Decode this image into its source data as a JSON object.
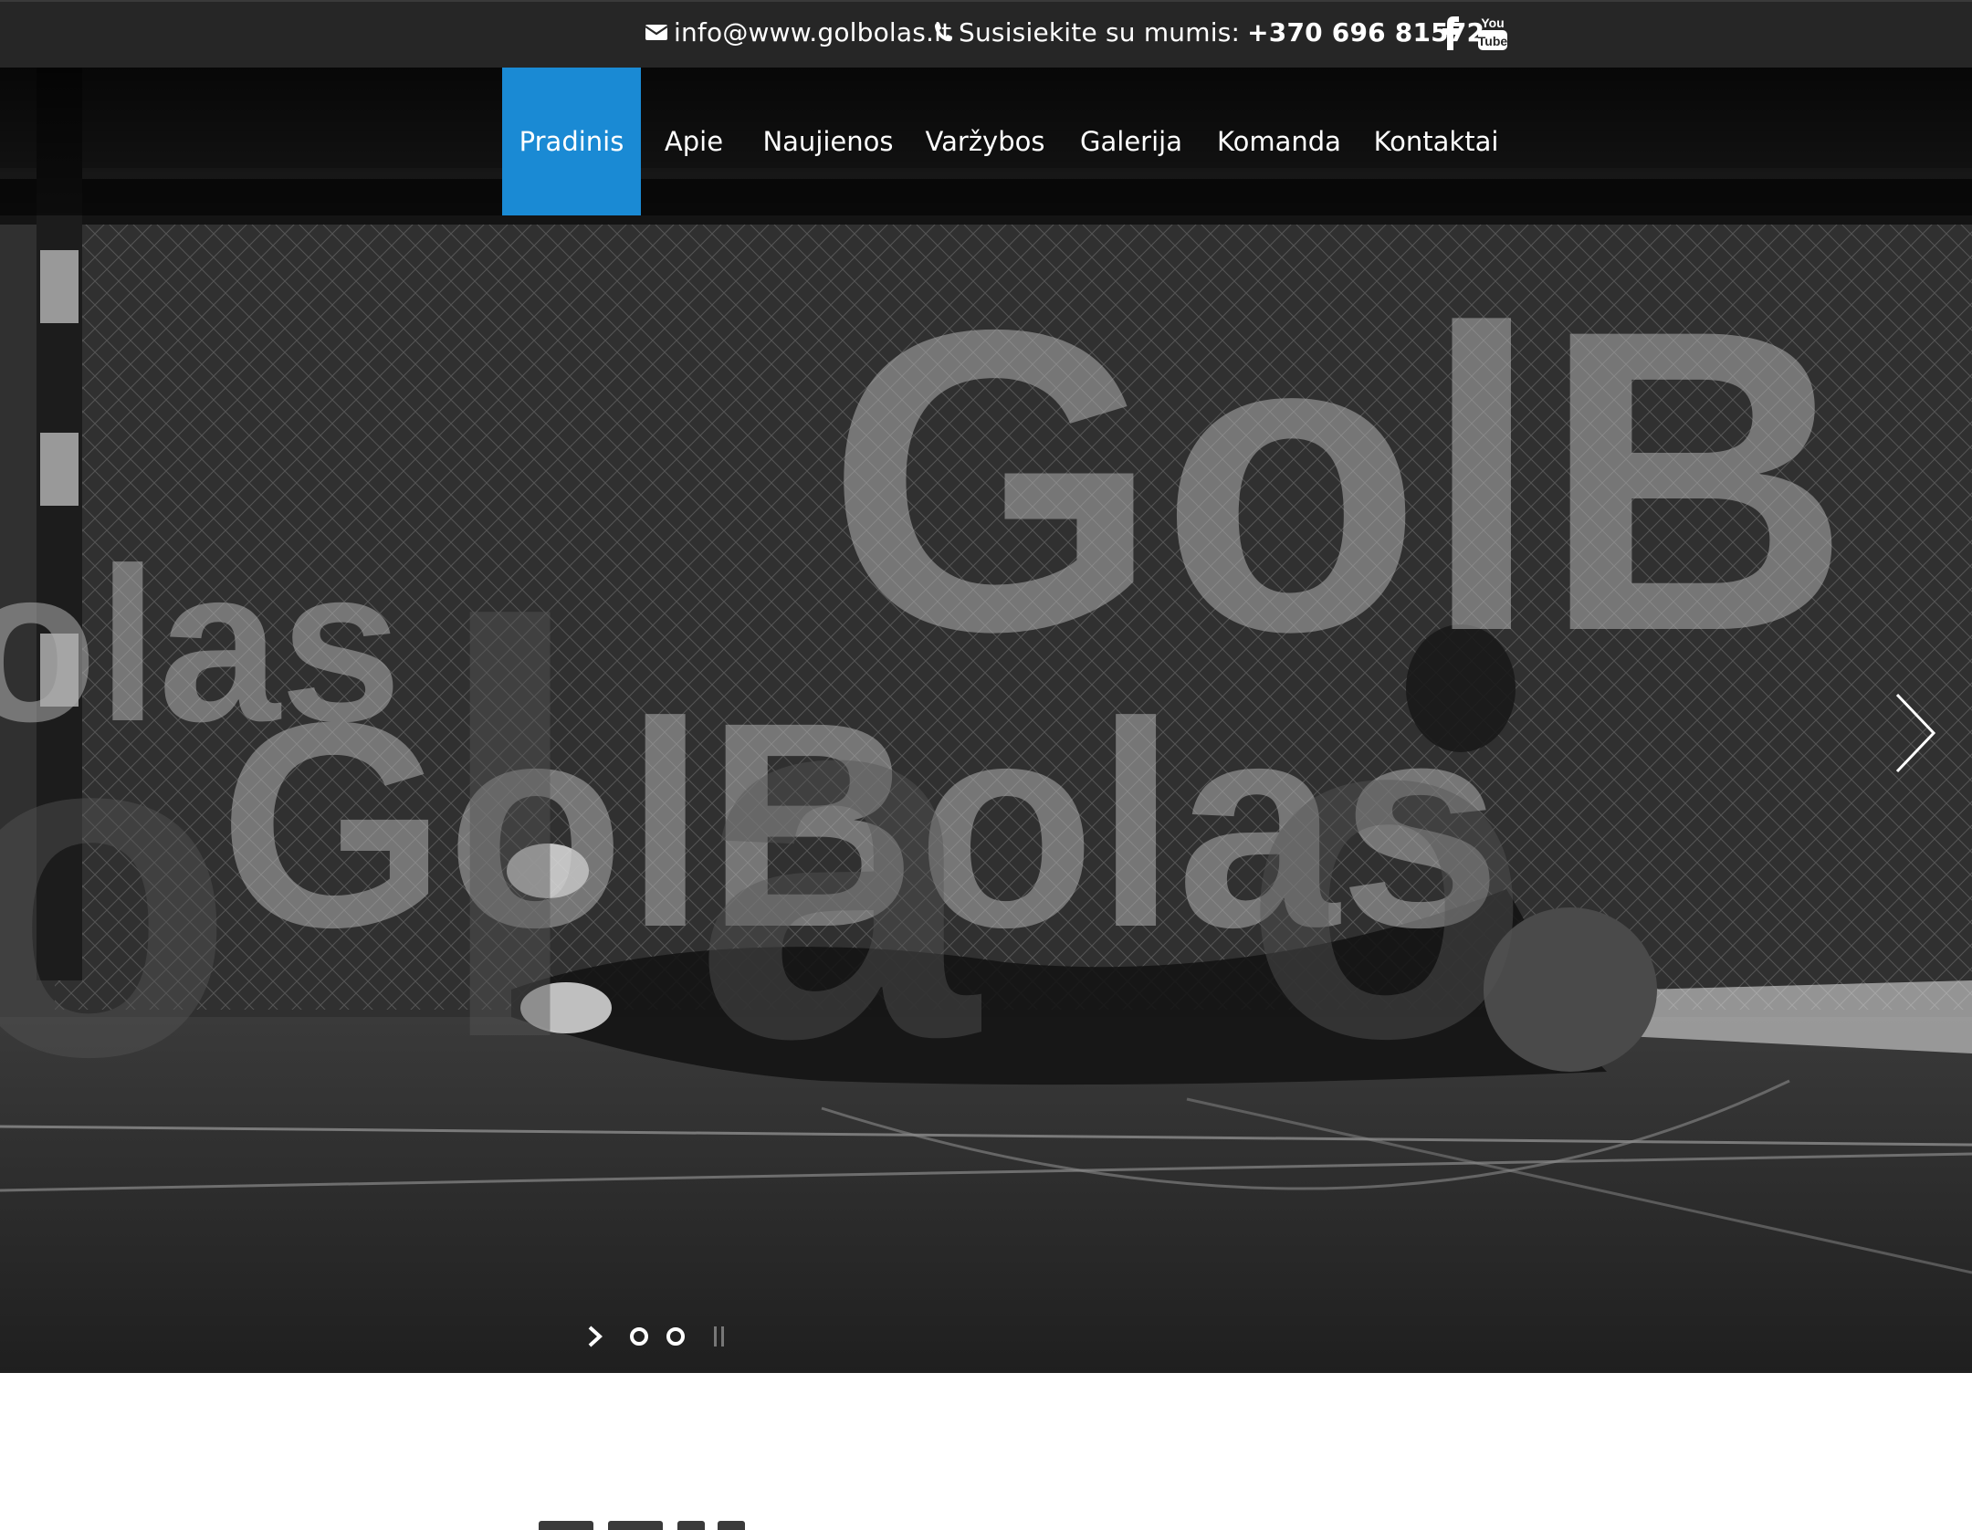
{
  "topbar": {
    "email": "info@www.golbolas.lt",
    "phone_label": "Susisiekite su mumis:",
    "phone_number": "+370 696 81572",
    "icons": {
      "email": "envelope-icon",
      "phone": "phone-icon",
      "facebook": "facebook-icon",
      "youtube": "youtube-icon"
    },
    "youtube_logo_text_top": "You",
    "youtube_logo_text_bottom": "Tube"
  },
  "nav": {
    "items": [
      {
        "label": "Pradinis",
        "active": true
      },
      {
        "label": "Apie",
        "active": false
      },
      {
        "label": "Naujienos",
        "active": false
      },
      {
        "label": "Varžybos",
        "active": false
      },
      {
        "label": "Galerija",
        "active": false
      },
      {
        "label": "Komanda",
        "active": false
      },
      {
        "label": "Kontaktai",
        "active": false
      }
    ],
    "active_color": "#1a8ad4"
  },
  "hero": {
    "overlay_words": [
      "olas",
      "GolB",
      "GolBolas",
      "o",
      "l",
      "a",
      "o"
    ],
    "slider": {
      "total_slides": 2,
      "icons": [
        "play-icon",
        "slide-dot-icon",
        "slide-dot-icon",
        "pause-icon"
      ],
      "next_icon": "chevron-right-icon"
    }
  }
}
